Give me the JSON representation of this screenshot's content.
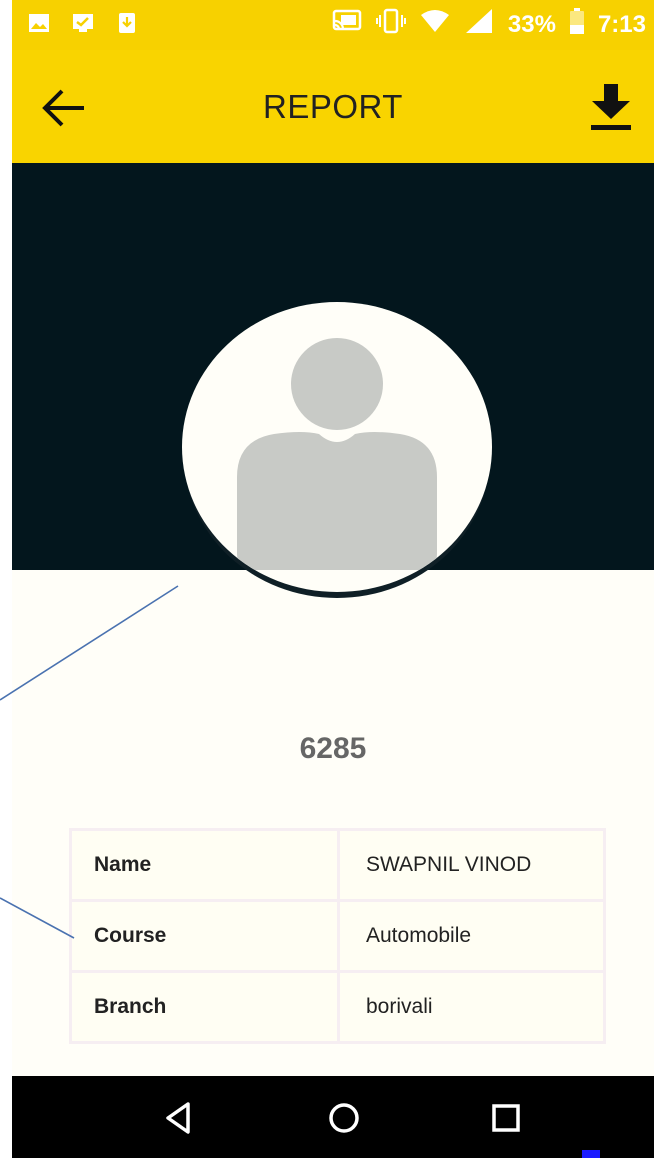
{
  "status_bar": {
    "battery_percent": "33%",
    "time": "7:13"
  },
  "toolbar": {
    "title": "REPORT"
  },
  "profile": {
    "registration_number": "6285"
  },
  "info_rows": [
    {
      "label": "Name",
      "value": "SWAPNIL VINOD"
    },
    {
      "label": "Course",
      "value": "Automobile"
    },
    {
      "label": "Branch",
      "value": "borivali"
    }
  ],
  "colors": {
    "toolbar_yellow": "#f9d400",
    "hero_dark": "#03161d",
    "avatar_placeholder": "#c8cac6",
    "annotation_line": "#4a72b0"
  },
  "icons": {
    "back": "arrow-left-icon",
    "download": "download-icon",
    "nav_back": "triangle-back-icon",
    "nav_home": "circle-home-icon",
    "nav_recent": "square-recent-icon"
  }
}
